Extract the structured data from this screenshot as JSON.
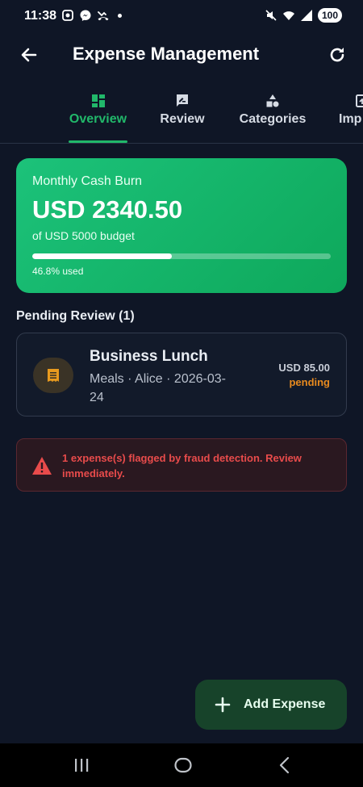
{
  "status_bar": {
    "time": "11:38",
    "battery": "100"
  },
  "app_bar": {
    "title": "Expense Management"
  },
  "tabs": [
    {
      "label": "Overview",
      "icon": "dashboard-icon",
      "active": true
    },
    {
      "label": "Review",
      "icon": "rate-review-icon",
      "active": false
    },
    {
      "label": "Categories",
      "icon": "category-icon",
      "active": false
    },
    {
      "label": "Imp",
      "icon": "import-icon",
      "active": false
    }
  ],
  "burn_card": {
    "label": "Monthly Cash Burn",
    "amount": "USD 2340.50",
    "budget": "of USD 5000 budget",
    "progress_fraction": 0.468,
    "progress_text": "46.8% used"
  },
  "pending": {
    "title": "Pending Review (1)",
    "items": [
      {
        "name": "Business Lunch",
        "meta": "Meals · Alice · 2026-03-24",
        "amount": "USD 85.00",
        "status": "pending",
        "icon": "receipt-icon"
      }
    ]
  },
  "alert": {
    "text": "1 expense(s) flagged by fraud detection. Review immediately.",
    "icon": "warning-icon"
  },
  "fab": {
    "label": "Add Expense",
    "icon": "plus-icon"
  },
  "colors": {
    "background": "#0f1626",
    "accent": "#21b86a",
    "card_green": "#12b268",
    "pending": "#e88a1e",
    "danger": "#e84b4b",
    "fab": "#17432a"
  }
}
